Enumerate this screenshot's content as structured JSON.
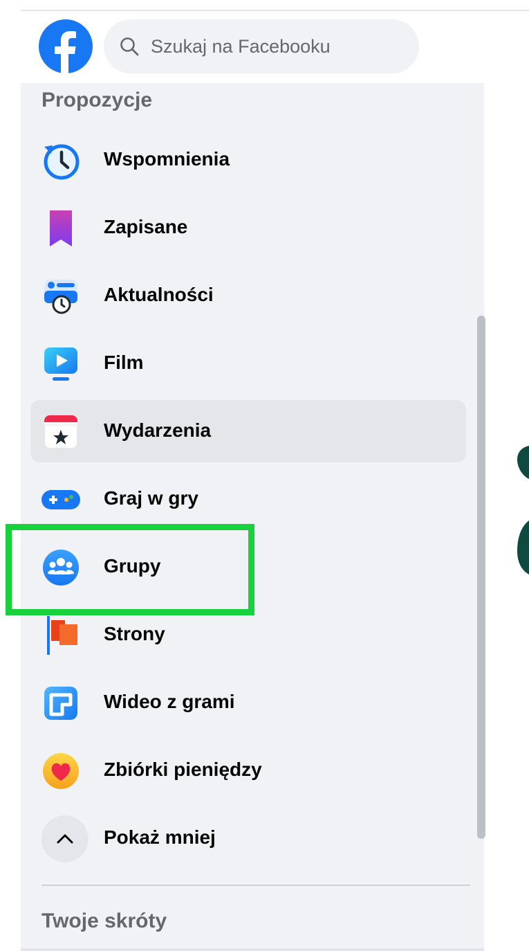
{
  "header": {
    "search_placeholder": "Szukaj na Facebooku"
  },
  "sidebar": {
    "section_suggestions": "Propozycje",
    "items": [
      {
        "label": "Wspomnienia",
        "icon": "memories-clock-icon"
      },
      {
        "label": "Zapisane",
        "icon": "saved-bookmark-icon"
      },
      {
        "label": "Aktualności",
        "icon": "feeds-icon"
      },
      {
        "label": "Film",
        "icon": "video-play-icon"
      },
      {
        "label": "Wydarzenia",
        "icon": "events-calendar-star-icon"
      },
      {
        "label": "Graj w gry",
        "icon": "gaming-controller-icon"
      },
      {
        "label": "Grupy",
        "icon": "groups-people-icon"
      },
      {
        "label": "Strony",
        "icon": "pages-flag-icon"
      },
      {
        "label": "Wideo z grami",
        "icon": "gaming-video-icon"
      },
      {
        "label": "Zbiórki pieniędzy",
        "icon": "fundraiser-heart-icon"
      }
    ],
    "show_less": "Pokaż mniej",
    "section_shortcuts": "Twoje skróty"
  },
  "colors": {
    "brand": "#1877f2",
    "highlight": "#17d23d",
    "sidebar_bg": "#f0f2f5",
    "secondary_text": "#65676b"
  }
}
